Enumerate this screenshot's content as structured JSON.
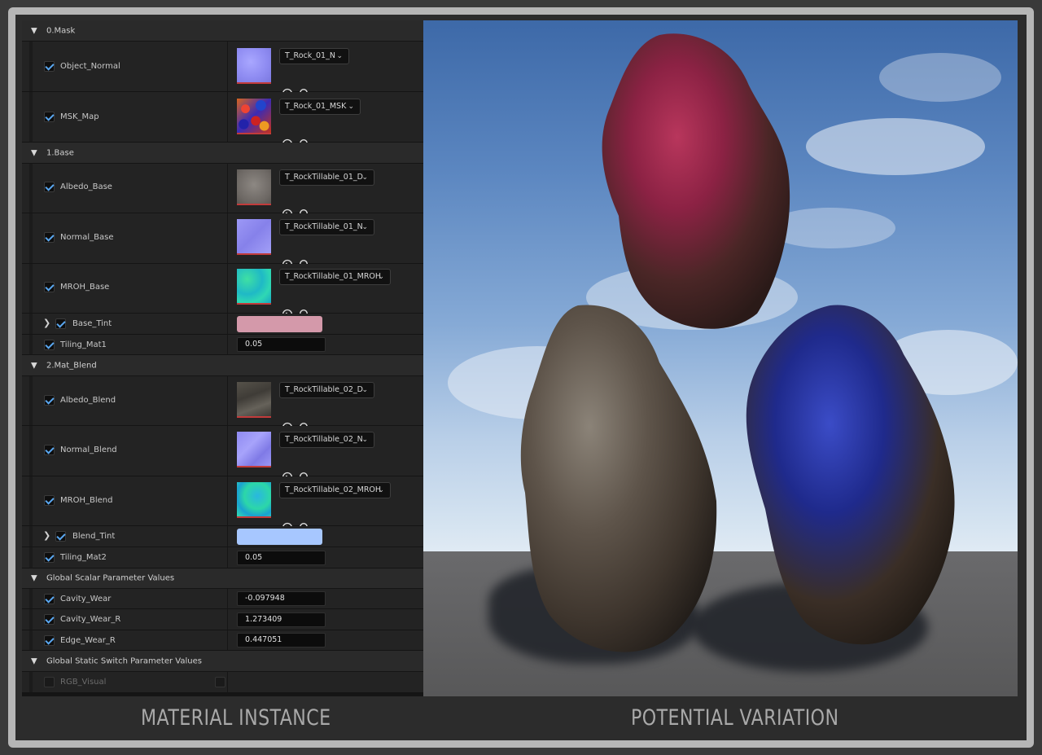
{
  "captions": {
    "left": "MATERIAL INSTANCE",
    "right": "POTENTIAL VARIATION"
  },
  "categories": {
    "mask": "0.Mask",
    "base": "1.Base",
    "blend": "2.Mat_Blend",
    "scalars": "Global Scalar Parameter Values",
    "switches": "Global Static Switch Parameter Values"
  },
  "params": {
    "object_normal": {
      "label": "Object_Normal",
      "texture": "T_Rock_01_N"
    },
    "msk_map": {
      "label": "MSK_Map",
      "texture": "T_Rock_01_MSK"
    },
    "albedo_base": {
      "label": "Albedo_Base",
      "texture": "T_RockTillable_01_D"
    },
    "normal_base": {
      "label": "Normal_Base",
      "texture": "T_RockTillable_01_N"
    },
    "mroh_base": {
      "label": "MROH_Base",
      "texture": "T_RockTillable_01_MROH"
    },
    "base_tint": {
      "label": "Base_Tint",
      "color": "#d499aa"
    },
    "tiling_mat1": {
      "label": "Tiling_Mat1",
      "value": "0.05"
    },
    "albedo_blend": {
      "label": "Albedo_Blend",
      "texture": "T_RockTillable_02_D"
    },
    "normal_blend": {
      "label": "Normal_Blend",
      "texture": "T_RockTillable_02_N"
    },
    "mroh_blend": {
      "label": "MROH_Blend",
      "texture": "T_RockTillable_02_MROH"
    },
    "blend_tint": {
      "label": "Blend_Tint",
      "color": "#a7c7ff"
    },
    "tiling_mat2": {
      "label": "Tiling_Mat2",
      "value": "0.05"
    },
    "cavity_wear": {
      "label": "Cavity_Wear",
      "value": "-0.097948"
    },
    "cavity_wear_r": {
      "label": "Cavity_Wear_R",
      "value": "1.273409"
    },
    "edge_wear_r": {
      "label": "Edge_Wear_R",
      "value": "0.447051"
    },
    "rgb_visual": {
      "label": "RGB_Visual"
    }
  },
  "icons": {
    "reset": "reset-arrow-icon",
    "browse": "search-icon",
    "expand": "chevron-right-icon",
    "collapse": "chevron-down-icon"
  },
  "colors": {
    "accent_check": "#5aa7f0",
    "thumb_underline": "#c23b3b"
  }
}
